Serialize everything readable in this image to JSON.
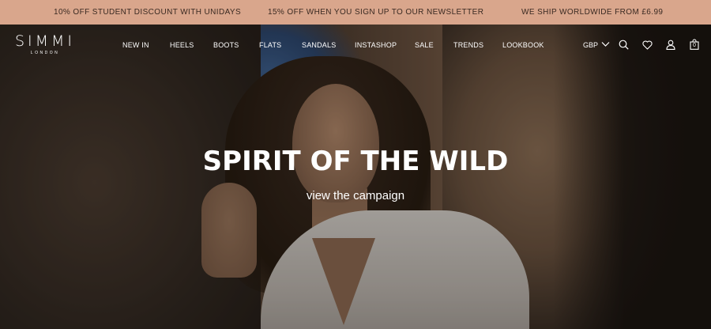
{
  "promo": {
    "items": [
      "10% OFF STUDENT DISCOUNT WITH UNIDAYS",
      "15% OFF WHEN YOU SIGN UP TO OUR NEWSLETTER",
      "WE SHIP WORLDWIDE FROM £6.99"
    ],
    "background": "#d9a68c"
  },
  "brand": {
    "name": "SIMMI",
    "location": "LONDON"
  },
  "nav": {
    "links": [
      "NEW IN",
      "HEELS",
      "BOOTS",
      "FLATS",
      "SANDALS",
      "INSTASHOP",
      "SALE",
      "TRENDS",
      "LOOKBOOK"
    ],
    "currency": "GBP",
    "icons": [
      "chevron-down-icon",
      "search-icon",
      "heart-icon",
      "user-icon",
      "bag-icon"
    ],
    "bag_count": "0"
  },
  "hero": {
    "title": "SPIRIT OF THE WILD",
    "cta": "view the campaign"
  }
}
